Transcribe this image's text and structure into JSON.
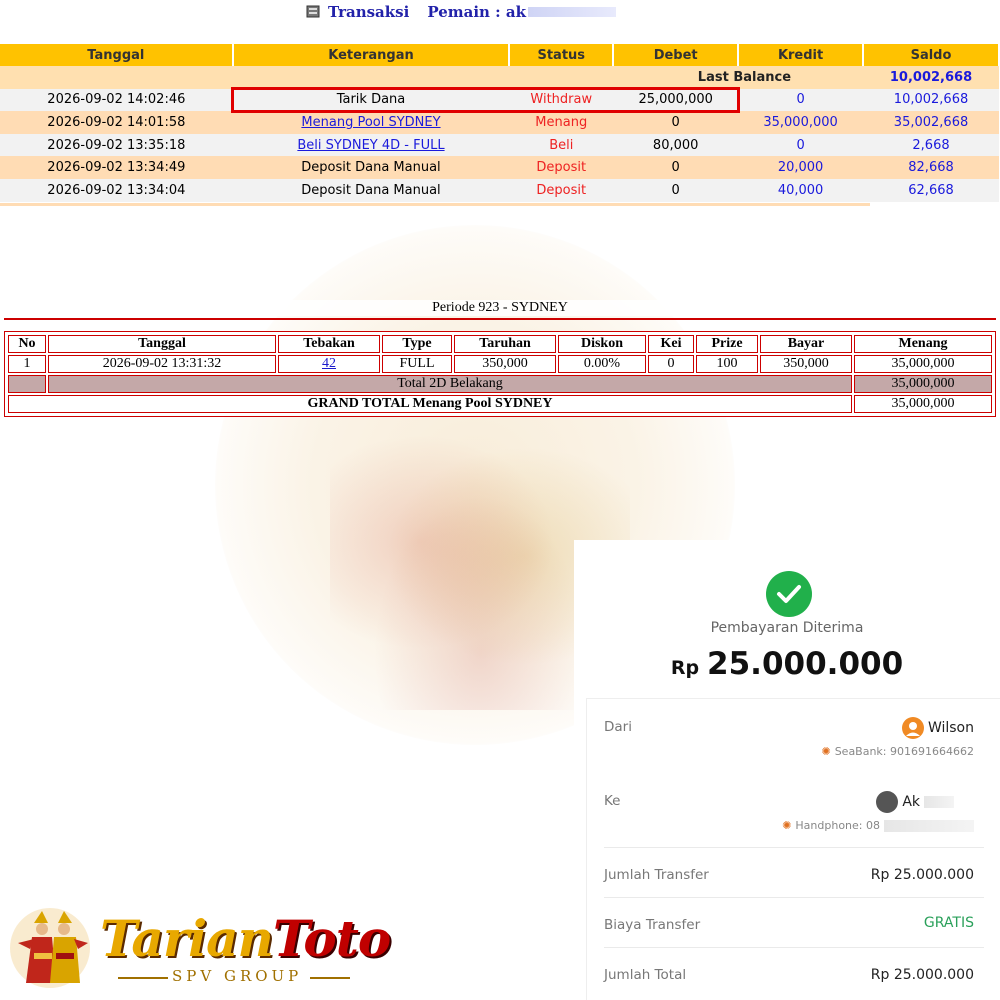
{
  "header": {
    "title": "Transaksi",
    "player_label": "Pemain : ak"
  },
  "transactions": {
    "columns": [
      "Tanggal",
      "Keterangan",
      "Status",
      "Debet",
      "Kredit",
      "Saldo"
    ],
    "last_balance_label": "Last Balance",
    "last_balance_value": "10,002,668",
    "rows": [
      {
        "tanggal": "2026-09-02 14:02:46",
        "keterangan": "Tarik Dana",
        "link": false,
        "status": "Withdraw",
        "debet": "25,000,000",
        "kredit": "0",
        "saldo": "10,002,668"
      },
      {
        "tanggal": "2026-09-02 14:01:58",
        "keterangan": "Menang Pool SYDNEY",
        "link": true,
        "status": "Menang",
        "debet": "0",
        "kredit": "35,000,000",
        "saldo": "35,002,668"
      },
      {
        "tanggal": "2026-09-02 13:35:18",
        "keterangan": "Beli SYDNEY 4D - FULL",
        "link": true,
        "status": "Beli",
        "debet": "80,000",
        "kredit": "0",
        "saldo": "2,668"
      },
      {
        "tanggal": "2026-09-02 13:34:49",
        "keterangan": "Deposit Dana Manual",
        "link": false,
        "status": "Deposit",
        "debet": "0",
        "kredit": "20,000",
        "saldo": "82,668"
      },
      {
        "tanggal": "2026-09-02 13:34:04",
        "keterangan": "Deposit Dana Manual",
        "link": false,
        "status": "Deposit",
        "debet": "0",
        "kredit": "40,000",
        "saldo": "62,668"
      }
    ]
  },
  "pool": {
    "periode": "Periode 923 - SYDNEY",
    "columns": [
      "No",
      "Tanggal",
      "Tebakan",
      "Type",
      "Taruhan",
      "Diskon",
      "Kei",
      "Prize",
      "Bayar",
      "Menang"
    ],
    "row": {
      "no": "1",
      "tanggal": "2026-09-02 13:31:32",
      "tebakan": "42",
      "type": "FULL",
      "taruhan": "350,000",
      "diskon": "0.00%",
      "kei": "0",
      "prize": "100",
      "bayar": "350,000",
      "menang": "35,000,000"
    },
    "subtotal_label": "Total 2D Belakang",
    "subtotal_value": "35,000,000",
    "grand_total_label": "GRAND TOTAL  Menang Pool SYDNEY",
    "grand_total_value": "35,000,000"
  },
  "receipt": {
    "title": "Pembayaran Diterima",
    "currency": "Rp",
    "amount": "25.000.000",
    "from_label": "Dari",
    "from_name": "Wilson",
    "from_bank": "SeaBank: 901691664662",
    "to_label": "Ke",
    "to_name": "Ak",
    "to_bank": "Handphone: 08",
    "jumlah_transfer_label": "Jumlah Transfer",
    "jumlah_transfer_value": "Rp 25.000.000",
    "biaya_label": "Biaya Transfer",
    "biaya_value": "GRATIS",
    "jumlah_total_label": "Jumlah Total",
    "jumlah_total_value": "Rp 25.000.000"
  },
  "logo": {
    "word1": "Tarian",
    "word2": "Toto",
    "sub": "SPV GROUP"
  },
  "colors": {
    "header_yellow": "#ffc200",
    "row_peach": "#ffdcb4",
    "status_red": "#ee2222",
    "link_blue": "#1a1adc",
    "highlight_red": "#e00000",
    "success_green": "#21b04b"
  }
}
